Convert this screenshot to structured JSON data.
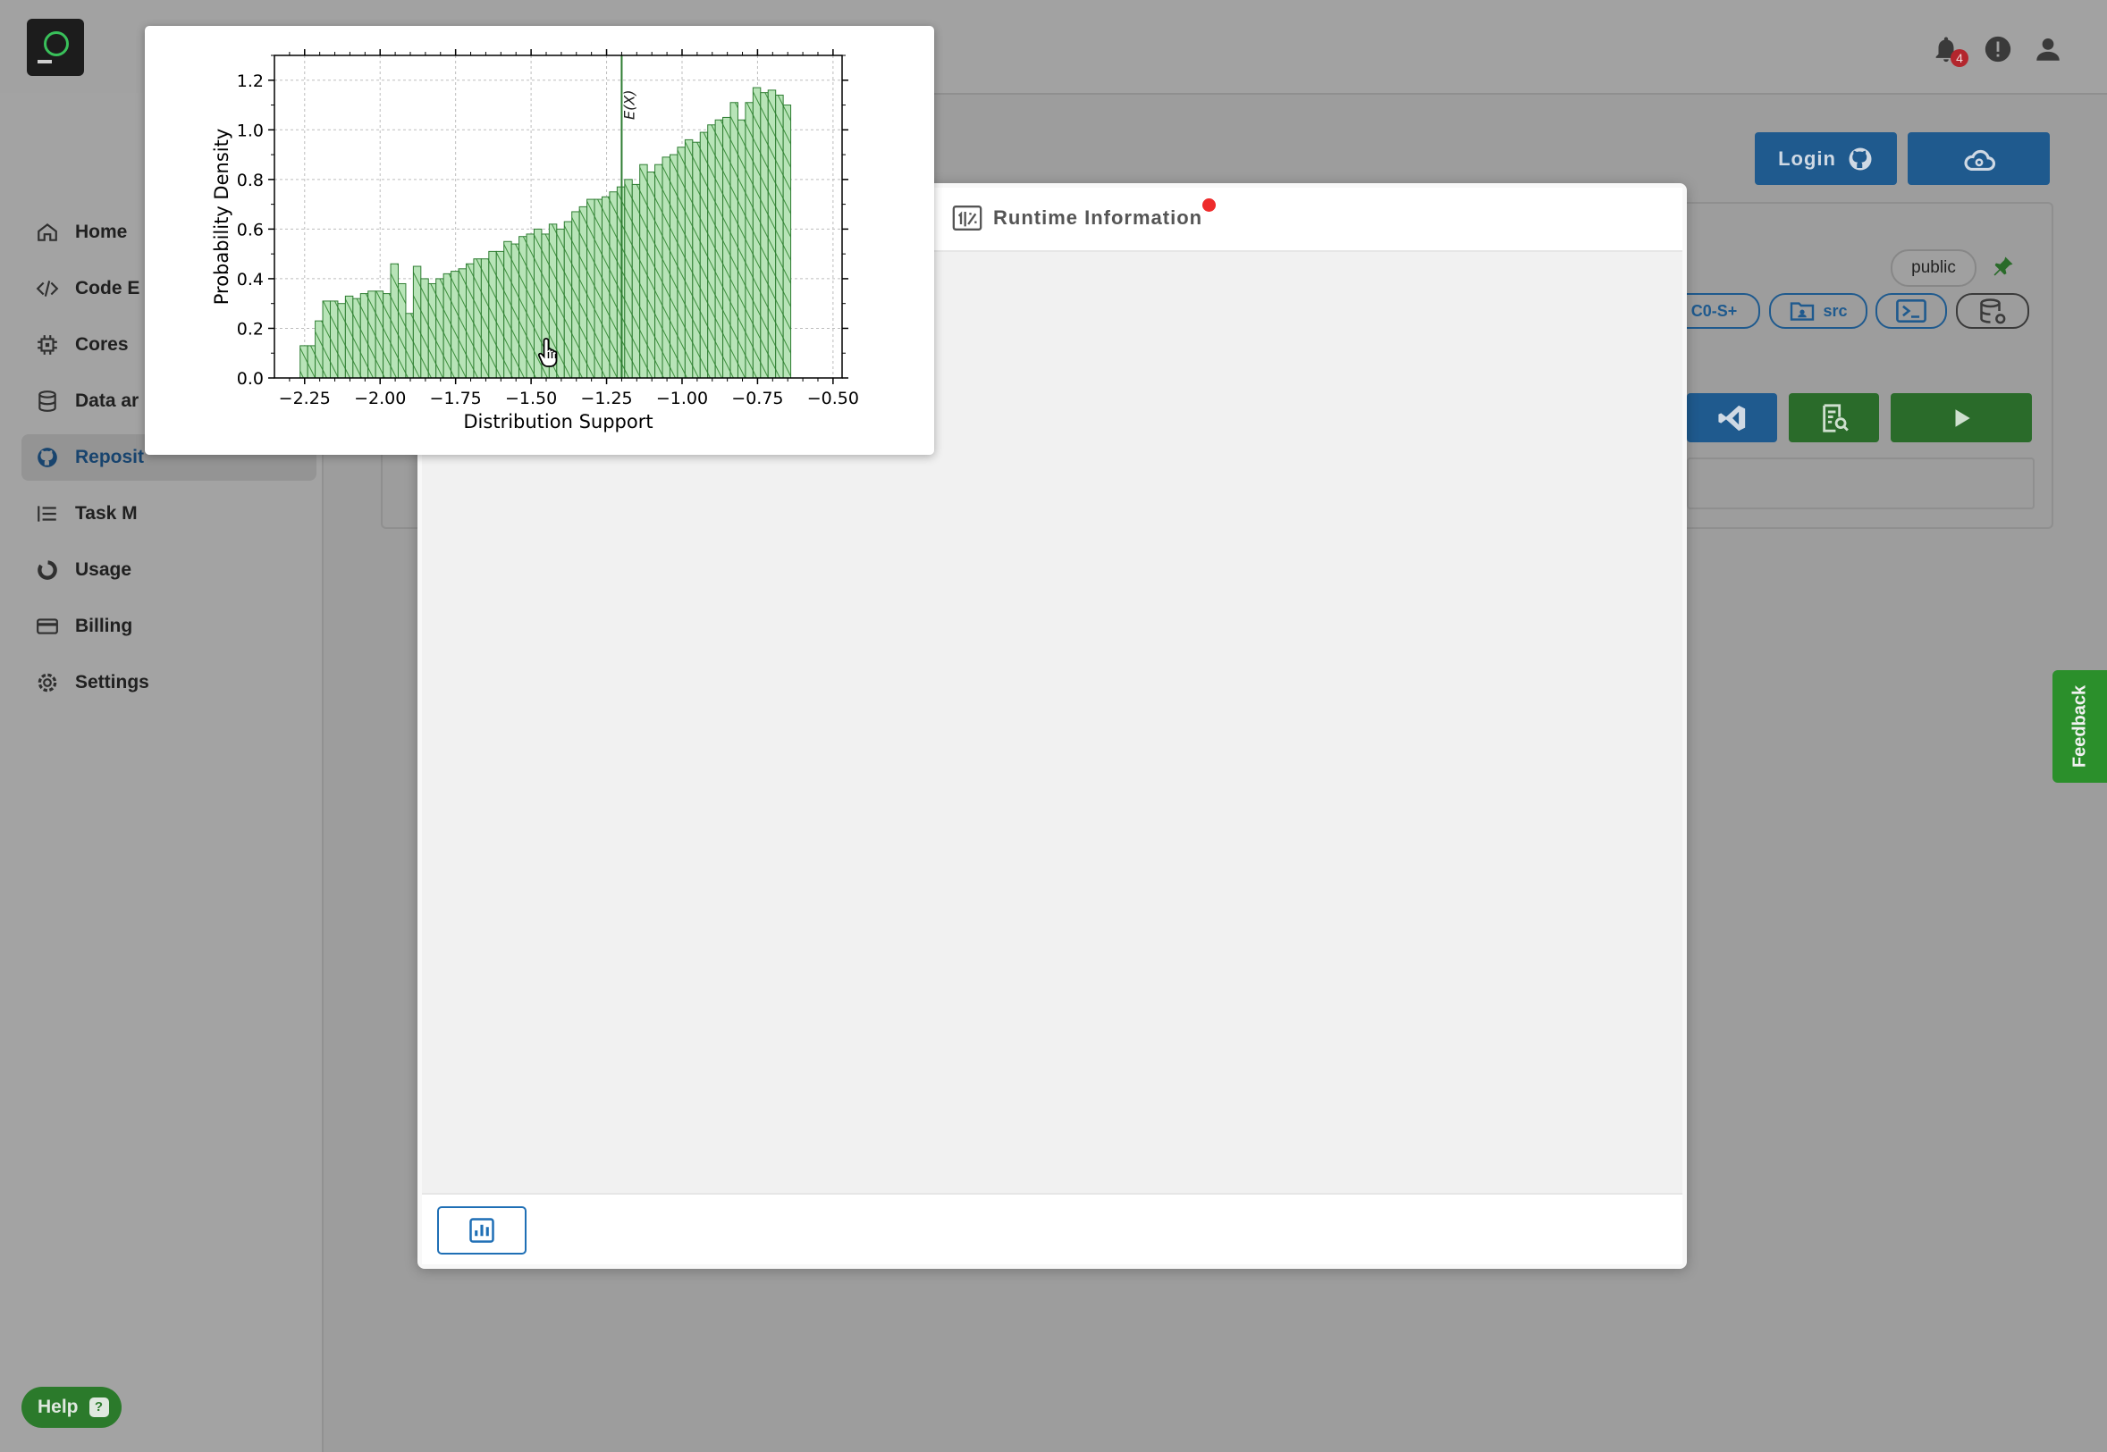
{
  "app": {
    "notifications_count": "4",
    "colors": {
      "accent": "#1f6fb5",
      "success": "#2e7d32",
      "danger": "#ee2b2b"
    }
  },
  "sidebar": {
    "items": [
      {
        "label": "Home",
        "icon": "home-icon"
      },
      {
        "label": "Code E",
        "icon": "code-icon"
      },
      {
        "label": "Cores",
        "icon": "chip-icon"
      },
      {
        "label": "Data ar",
        "icon": "database-icon"
      },
      {
        "label": "Reposit",
        "icon": "github-icon",
        "active": true
      },
      {
        "label": "Task M",
        "icon": "list-icon"
      },
      {
        "label": "Usage",
        "icon": "usage-icon"
      },
      {
        "label": "Billing",
        "icon": "card-icon"
      },
      {
        "label": "Settings",
        "icon": "gear-icon"
      }
    ]
  },
  "header": {
    "login_label": "Login"
  },
  "repo": {
    "visibility": "public",
    "chip_cores": "C0-S+",
    "chip_src": "src"
  },
  "feedback_label": "Feedback",
  "help_label": "Help",
  "modal": {
    "tab_label": "Runtime Information"
  },
  "chart_data": {
    "type": "bar",
    "title": "",
    "xlabel": "Distribution Support",
    "ylabel": "Probability Density",
    "xlim": [
      -2.35,
      -0.47
    ],
    "ylim": [
      0,
      1.3
    ],
    "xticks": [
      -2.25,
      -2.0,
      -1.75,
      -1.5,
      -1.25,
      -1.0,
      -0.75,
      -0.5
    ],
    "xtick_labels": [
      "−2.25",
      "−2.00",
      "−1.75",
      "−1.50",
      "−1.25",
      "−1.00",
      "−0.75",
      "−0.50"
    ],
    "yticks": [
      0.0,
      0.2,
      0.4,
      0.6,
      0.8,
      1.0,
      1.2
    ],
    "ytick_labels": [
      "0.0",
      "0.2",
      "0.4",
      "0.6",
      "0.8",
      "1.0",
      "1.2"
    ],
    "grid": true,
    "bin_start": -2.265,
    "bin_width": 0.025,
    "values": [
      0.13,
      0.13,
      0.23,
      0.31,
      0.31,
      0.3,
      0.33,
      0.32,
      0.34,
      0.35,
      0.35,
      0.34,
      0.46,
      0.38,
      0.26,
      0.45,
      0.4,
      0.38,
      0.4,
      0.42,
      0.43,
      0.44,
      0.46,
      0.48,
      0.48,
      0.51,
      0.51,
      0.55,
      0.54,
      0.57,
      0.58,
      0.6,
      0.58,
      0.62,
      0.6,
      0.63,
      0.67,
      0.69,
      0.72,
      0.72,
      0.73,
      0.75,
      0.77,
      0.8,
      0.78,
      0.86,
      0.83,
      0.86,
      0.89,
      0.9,
      0.93,
      0.96,
      0.95,
      0.99,
      1.02,
      1.04,
      1.05,
      1.11,
      1.04,
      1.11,
      1.17,
      1.15,
      1.16,
      1.14,
      1.1
    ],
    "vline": {
      "x": -1.2,
      "label": "E(X)"
    },
    "bar_color": "#b8e4b8",
    "edge_color": "#2e7d32"
  }
}
